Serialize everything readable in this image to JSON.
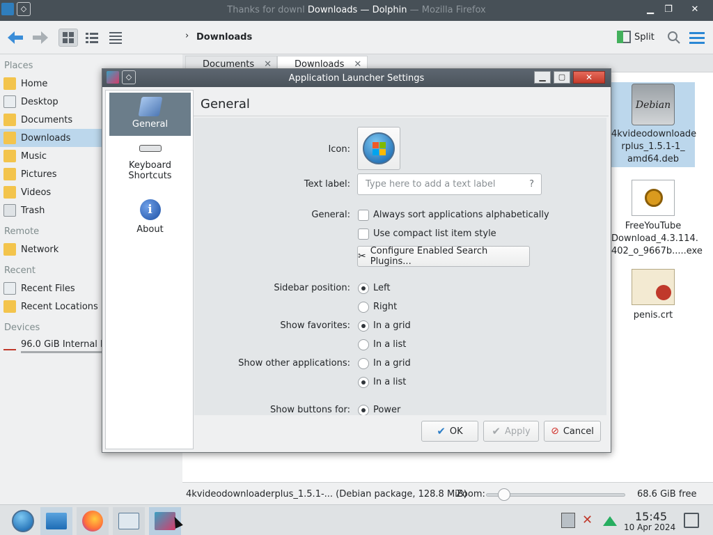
{
  "window": {
    "title_prefix": "Thanks for downl",
    "title_main": "Downloads — Dolphin",
    "title_suffix": "— Mozilla Firefox"
  },
  "toolbar": {
    "breadcrumb": "Downloads",
    "split_label": "Split"
  },
  "sidebar": {
    "places_header": "Places",
    "places": [
      {
        "label": "Home"
      },
      {
        "label": "Desktop"
      },
      {
        "label": "Documents"
      },
      {
        "label": "Downloads"
      },
      {
        "label": "Music"
      },
      {
        "label": "Pictures"
      },
      {
        "label": "Videos"
      },
      {
        "label": "Trash"
      }
    ],
    "remote_header": "Remote",
    "remote": [
      {
        "label": "Network"
      }
    ],
    "recent_header": "Recent",
    "recent": [
      {
        "label": "Recent Files"
      },
      {
        "label": "Recent Locations"
      }
    ],
    "devices_header": "Devices",
    "devices": [
      {
        "label": "96.0 GiB Internal D"
      }
    ]
  },
  "tabs": [
    {
      "label": "Documents"
    },
    {
      "label": "Downloads"
    }
  ],
  "files": [
    {
      "name_l1": "4kvideodownloade",
      "name_l2": "rplus_1.5.1-1_",
      "name_l3": "amd64.deb",
      "icon": "debian-package-icon"
    },
    {
      "name_l1": "FreeYouTube",
      "name_l2": "Download_4.3.114.",
      "name_l3": "402_o_9667b.....exe",
      "icon": "exe-icon"
    },
    {
      "name_l1": "penis.crt",
      "icon": "certificate-icon"
    }
  ],
  "status": {
    "selection": "4kvideodownloaderplus_1.5.1-... (Debian package, 128.8 MiB)",
    "zoom_label": "Zoom:",
    "zoom_level": 0.13,
    "free": "68.6 GiB free"
  },
  "dialog": {
    "title": "Application Launcher Settings",
    "categories": [
      {
        "label": "General"
      },
      {
        "label_l1": "Keyboard",
        "label_l2": "Shortcuts"
      },
      {
        "label": "About"
      }
    ],
    "page_title": "General",
    "icon_label": "Icon:",
    "text_label_label": "Text label:",
    "text_label_placeholder": "Type here to add a text label",
    "text_label_help": "?",
    "general_label": "General:",
    "opt_sort": "Always sort applications alphabetically",
    "opt_compact": "Use compact list item style",
    "configure_button": "Configure Enabled Search Plugins...",
    "sidebar_position_label": "Sidebar position:",
    "sidebar_left": "Left",
    "sidebar_right": "Right",
    "show_favorites_label": "Show favorites:",
    "fav_grid": "In a grid",
    "fav_list": "In a list",
    "show_other_label": "Show other applications:",
    "other_grid": "In a grid",
    "other_list": "In a list",
    "show_buttons_label": "Show buttons for:",
    "buttons_power": "Power",
    "ok": "OK",
    "apply": "Apply",
    "cancel": "Cancel"
  },
  "clock": {
    "time": "15:45",
    "date": "10 Apr 2024"
  }
}
